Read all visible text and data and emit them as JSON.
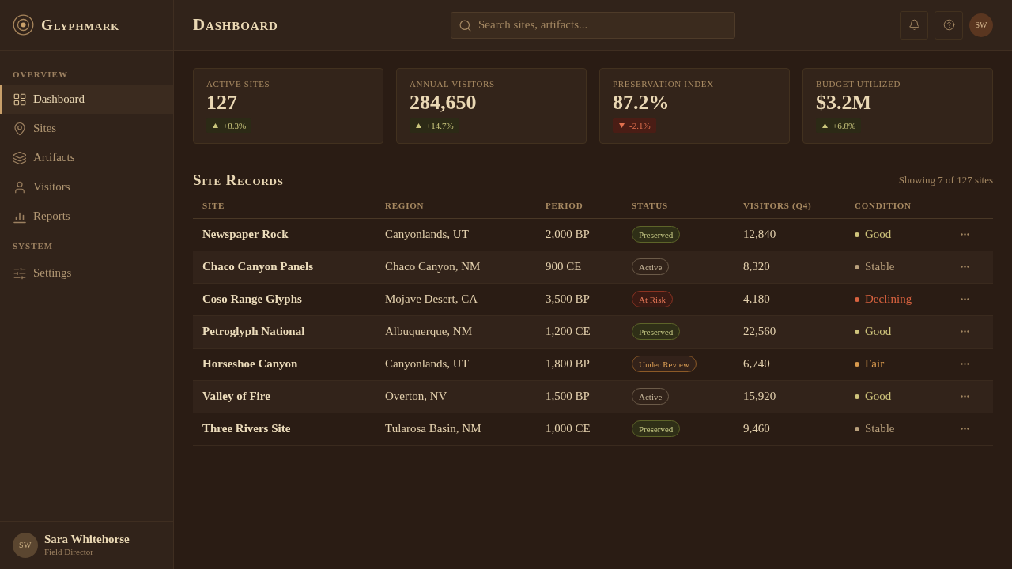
{
  "sidebar": {
    "brand": "Glyphmark",
    "sections": [
      {
        "heading": "OVERVIEW",
        "items": [
          {
            "label": "Dashboard",
            "selected": true
          },
          {
            "label": "Sites",
            "selected": false
          },
          {
            "label": "Artifacts",
            "selected": false
          },
          {
            "label": "Visitors",
            "selected": false
          },
          {
            "label": "Reports",
            "selected": false
          }
        ]
      },
      {
        "heading": "SYSTEM",
        "items": [
          {
            "label": "Settings",
            "selected": false
          }
        ]
      }
    ],
    "user": {
      "initials": "SW",
      "name": "Sara Whitehorse",
      "role": "Field Director"
    }
  },
  "header": {
    "title": "Dashboard",
    "search": {
      "placeholder": "Search sites, artifacts..."
    },
    "avatar": "SW"
  },
  "stats": [
    {
      "label": "ACTIVE SITES",
      "value": "127",
      "delta": "+8.3%",
      "kind": "up"
    },
    {
      "label": "ANNUAL VISITORS",
      "value": "284,650",
      "delta": "+14.7%",
      "kind": "up"
    },
    {
      "label": "PRESERVATION INDEX",
      "value": "87.2%",
      "delta": "-2.1%",
      "kind": "down"
    },
    {
      "label": "BUDGET UTILIZED",
      "value": "$3.2M",
      "delta": "+6.8%",
      "kind": "up"
    }
  ],
  "records": {
    "title": "Site Records",
    "summary": "Showing 7 of 127 sites",
    "columns": [
      "SITE",
      "REGION",
      "PERIOD",
      "STATUS",
      "VISITORS (Q4)",
      "CONDITION"
    ],
    "rows": [
      {
        "site": "Newspaper Rock",
        "region": "Canyonlands, UT",
        "period": "2,000 BP",
        "status": {
          "label": "Preserved",
          "kind": "positive"
        },
        "visitors": "12,840",
        "condition": {
          "label": "Good",
          "color": "#cfc47c"
        }
      },
      {
        "site": "Chaco Canyon Panels",
        "region": "Chaco Canyon, NM",
        "period": "900 CE",
        "status": {
          "label": "Active",
          "kind": "neutral"
        },
        "visitors": "8,320",
        "condition": {
          "label": "Stable",
          "color": "#b9a07c"
        }
      },
      {
        "site": "Coso Range Glyphs",
        "region": "Mojave Desert, CA",
        "period": "3,500 BP",
        "status": {
          "label": "At Risk",
          "kind": "danger"
        },
        "visitors": "4,180",
        "condition": {
          "label": "Declining",
          "color": "#d9623f"
        }
      },
      {
        "site": "Petroglyph National",
        "region": "Albuquerque, NM",
        "period": "1,200 CE",
        "status": {
          "label": "Preserved",
          "kind": "positive"
        },
        "visitors": "22,560",
        "condition": {
          "label": "Good",
          "color": "#cfc47c"
        }
      },
      {
        "site": "Horseshoe Canyon",
        "region": "Canyonlands, UT",
        "period": "1,800 BP",
        "status": {
          "label": "Under Review",
          "kind": "warning"
        },
        "visitors": "6,740",
        "condition": {
          "label": "Fair",
          "color": "#d99a4e"
        }
      },
      {
        "site": "Valley of Fire",
        "region": "Overton, NV",
        "period": "1,500 BP",
        "status": {
          "label": "Active",
          "kind": "neutral"
        },
        "visitors": "15,920",
        "condition": {
          "label": "Good",
          "color": "#cfc47c"
        }
      },
      {
        "site": "Three Rivers Site",
        "region": "Tularosa Basin, NM",
        "period": "1,000 CE",
        "status": {
          "label": "Preserved",
          "kind": "positive"
        },
        "visitors": "9,460",
        "condition": {
          "label": "Stable",
          "color": "#b9a07c"
        }
      }
    ]
  }
}
